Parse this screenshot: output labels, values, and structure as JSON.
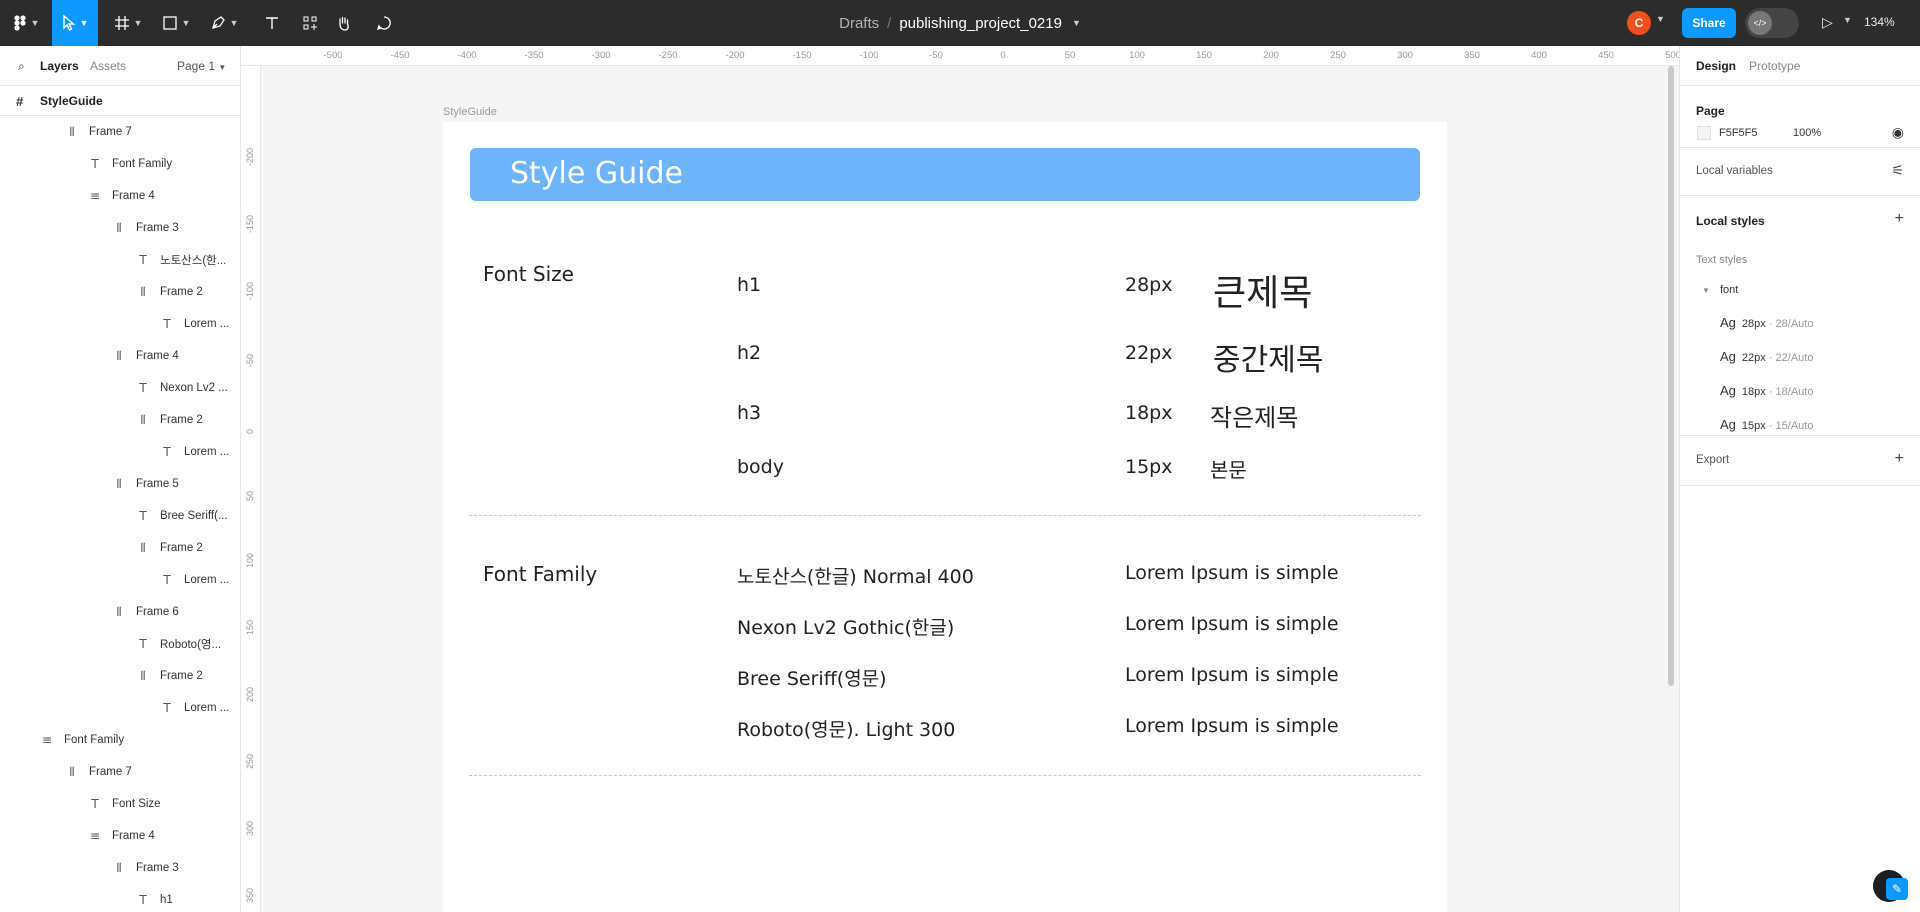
{
  "toolbar": {
    "crumb_folder": "Drafts",
    "crumb_sep": "/",
    "file_name": "publishing_project_0219",
    "avatar_initial": "C",
    "share_label": "Share",
    "zoom": "134%"
  },
  "layers_panel": {
    "tab_layers": "Layers",
    "tab_assets": "Assets",
    "page": "Page 1",
    "root": "StyleGuide",
    "items": [
      {
        "label": "Frame 7",
        "icon": "autolayout-vertical-icon"
      },
      {
        "label": "Font Family",
        "icon": "text-icon"
      },
      {
        "label": "Frame 4",
        "icon": "autolayout-horizontal-icon"
      },
      {
        "label": "Frame 3",
        "icon": "autolayout-vertical-icon"
      },
      {
        "label": "노토산스(한...",
        "icon": "text-icon"
      },
      {
        "label": "Frame 2",
        "icon": "autolayout-vertical-icon"
      },
      {
        "label": "Lorem ...",
        "icon": "text-icon"
      },
      {
        "label": "Frame 4",
        "icon": "autolayout-vertical-icon"
      },
      {
        "label": "Nexon Lv2 ...",
        "icon": "text-icon"
      },
      {
        "label": "Frame 2",
        "icon": "autolayout-vertical-icon"
      },
      {
        "label": "Lorem ...",
        "icon": "text-icon"
      },
      {
        "label": "Frame 5",
        "icon": "autolayout-vertical-icon"
      },
      {
        "label": "Bree Seriff(...",
        "icon": "text-icon"
      },
      {
        "label": "Frame 2",
        "icon": "autolayout-vertical-icon"
      },
      {
        "label": "Lorem ...",
        "icon": "text-icon"
      },
      {
        "label": "Frame 6",
        "icon": "autolayout-vertical-icon"
      },
      {
        "label": "Roboto(영...",
        "icon": "text-icon"
      },
      {
        "label": "Frame 2",
        "icon": "autolayout-vertical-icon"
      },
      {
        "label": "Lorem ...",
        "icon": "text-icon"
      },
      {
        "label": "Font Family",
        "icon": "autolayout-horizontal-icon"
      },
      {
        "label": "Frame 7",
        "icon": "autolayout-vertical-icon"
      },
      {
        "label": "Font Size",
        "icon": "text-icon"
      },
      {
        "label": "Frame 4",
        "icon": "autolayout-horizontal-icon"
      },
      {
        "label": "Frame 3",
        "icon": "autolayout-vertical-icon"
      },
      {
        "label": "h1",
        "icon": "text-icon"
      }
    ]
  },
  "canvas": {
    "ruler_top": [
      "-500",
      "-450",
      "-400",
      "-350",
      "-300",
      "-250",
      "-200",
      "-150",
      "-100",
      "-50",
      "0",
      "50",
      "100",
      "150",
      "200",
      "250",
      "300",
      "350",
      "400",
      "450",
      "500"
    ],
    "ruler_left": [
      "-200",
      "-150",
      "-100",
      "-50",
      "0",
      "50",
      "100",
      "150",
      "200",
      "250",
      "300",
      "350"
    ],
    "frame_label": "StyleGuide",
    "title": "Style Guide",
    "font_size_label": "Font Size",
    "font_sizes": [
      {
        "tag": "h1",
        "px": "28px",
        "sample": "큰제목"
      },
      {
        "tag": "h2",
        "px": "22px",
        "sample": "중간제목"
      },
      {
        "tag": "h3",
        "px": "18px",
        "sample": "작은제목"
      },
      {
        "tag": "body",
        "px": "15px",
        "sample": "본문"
      }
    ],
    "font_family_label": "Font Family",
    "font_families": [
      {
        "name": "노토산스(한글) Normal 400",
        "sample": "Lorem Ipsum is simple"
      },
      {
        "name": "Nexon Lv2 Gothic(한글)",
        "sample": "Lorem Ipsum is simple"
      },
      {
        "name": "Bree Seriff(영문)",
        "sample": "Lorem Ipsum is simple"
      },
      {
        "name": "Roboto(영문). Light 300",
        "sample": "Lorem Ipsum is simple"
      }
    ],
    "banner_color": "#6db4fb"
  },
  "design_panel": {
    "tab_design": "Design",
    "tab_prototype": "Prototype",
    "page_title": "Page",
    "page_color": "F5F5F5",
    "page_opacity": "100%",
    "local_variables": "Local variables",
    "local_styles": "Local styles",
    "text_styles": "Text styles",
    "group": "font",
    "styles": [
      {
        "ag": "Ag",
        "size": "28px",
        "meta": " · 28/Auto"
      },
      {
        "ag": "Ag",
        "size": "22px",
        "meta": " · 22/Auto"
      },
      {
        "ag": "Ag",
        "size": "18px",
        "meta": " · 18/Auto"
      },
      {
        "ag": "Ag",
        "size": "15px",
        "meta": " · 15/Auto"
      }
    ],
    "export": "Export"
  }
}
